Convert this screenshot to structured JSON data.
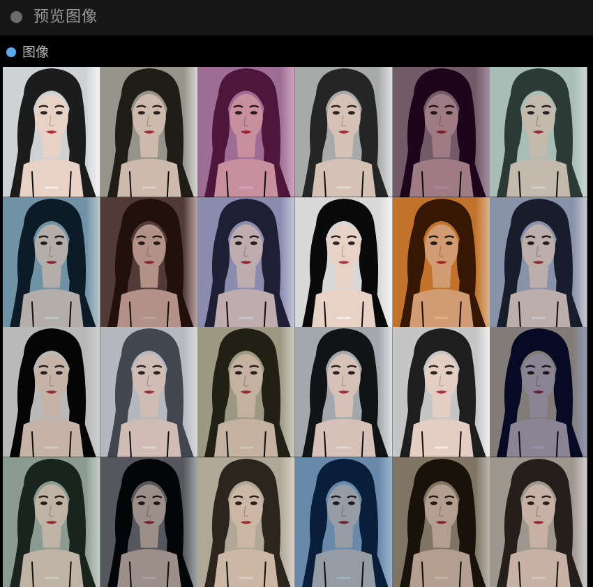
{
  "window": {
    "title": "预览图像"
  },
  "section": {
    "label": "图像",
    "accent_color": "#5aaaf0"
  },
  "grid": {
    "rows": 4,
    "columns": 6,
    "thumbnails": [
      {
        "filter": "original",
        "bg": "#cfd2d4",
        "tint": "#c8c8c8",
        "opacity": 0.0,
        "hair": "#1c1c1c"
      },
      {
        "filter": "warm-gray",
        "bg": "#a9a79e",
        "tint": "#8c8a7a",
        "opacity": 0.25,
        "hair": "#222018"
      },
      {
        "filter": "magenta",
        "bg": "#b7a0bb",
        "tint": "#b04a8c",
        "opacity": 0.45,
        "hair": "#5a2048"
      },
      {
        "filter": "muted",
        "bg": "#b7b8b8",
        "tint": "#999999",
        "opacity": 0.2,
        "hair": "#282828"
      },
      {
        "filter": "purple-vignette",
        "bg": "#a89a9a",
        "tint": "#4a1444",
        "opacity": 0.45,
        "hair": "#2a0a28"
      },
      {
        "filter": "teal-fade",
        "bg": "#c6d6d0",
        "tint": "#7a9c90",
        "opacity": 0.3,
        "hair": "#34413c"
      },
      {
        "filter": "cool-blue",
        "bg": "#8fb0c0",
        "tint": "#3d6d88",
        "opacity": 0.3,
        "hair": "#10202c"
      },
      {
        "filter": "sepia-dark",
        "bg": "#6a5450",
        "tint": "#6a3a34",
        "opacity": 0.4,
        "hair": "#2a1610"
      },
      {
        "filter": "lavender",
        "bg": "#a7abc6",
        "tint": "#7a7aaa",
        "opacity": 0.35,
        "hair": "#24243a"
      },
      {
        "filter": "high-contrast-bw",
        "bg": "#d8d8d8",
        "tint": "#ffffff",
        "opacity": 0.15,
        "hair": "#0a0a0a"
      },
      {
        "filter": "amber",
        "bg": "#d69a4a",
        "tint": "#c86e10",
        "opacity": 0.45,
        "hair": "#3a1e04"
      },
      {
        "filter": "slate",
        "bg": "#a8b0c2",
        "tint": "#5c6c8c",
        "opacity": 0.3,
        "hair": "#1c2230"
      },
      {
        "filter": "dramatic",
        "bg": "#dadada",
        "tint": "#000000",
        "opacity": 0.15,
        "hair": "#050505"
      },
      {
        "filter": "faded",
        "bg": "#cbcdd2",
        "tint": "#b0b4bc",
        "opacity": 0.35,
        "hair": "#4a4e56"
      },
      {
        "filter": "olive",
        "bg": "#b8b6a2",
        "tint": "#7c7a58",
        "opacity": 0.3,
        "hair": "#26251a"
      },
      {
        "filter": "crisp",
        "bg": "#b2b6ba",
        "tint": "#6e7880",
        "opacity": 0.15,
        "hair": "#121416"
      },
      {
        "filter": "noir",
        "bg": "#c8c8c8",
        "tint": "#eeeeee",
        "opacity": 0.25,
        "hair": "#1e1e1e"
      },
      {
        "filter": "navy-gold",
        "bg": "#d8c6a0",
        "tint": "#1a2c70",
        "opacity": 0.45,
        "hair": "#0a1030"
      },
      {
        "filter": "green-fade",
        "bg": "#aab6ae",
        "tint": "#6a8474",
        "opacity": 0.3,
        "hair": "#1e2a24"
      },
      {
        "filter": "deep-shadow",
        "bg": "#7e8086",
        "tint": "#10121a",
        "opacity": 0.35,
        "hair": "#05060a"
      },
      {
        "filter": "beige",
        "bg": "#c8c2b4",
        "tint": "#a89c84",
        "opacity": 0.35,
        "hair": "#302a22"
      },
      {
        "filter": "ocean",
        "bg": "#a0b8cc",
        "tint": "#1e5c96",
        "opacity": 0.4,
        "hair": "#0c2844"
      },
      {
        "filter": "coffee",
        "bg": "#a39c88",
        "tint": "#5a4a32",
        "opacity": 0.35,
        "hair": "#1e180e"
      },
      {
        "filter": "dusty",
        "bg": "#b8b3ac",
        "tint": "#86786c",
        "opacity": 0.3,
        "hair": "#2a2420"
      }
    ]
  }
}
